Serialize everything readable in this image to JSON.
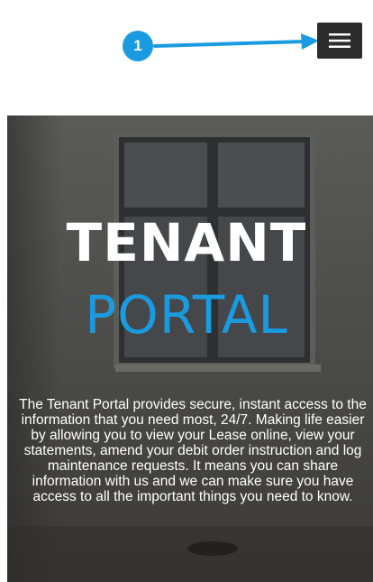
{
  "annotation": {
    "number": "1"
  },
  "menu_button": {
    "icon": "hamburger-icon"
  },
  "hero": {
    "title_line1": "TENANT",
    "title_line2": "PORTAL",
    "title_line2_color": "#1a9be0",
    "description": "The Tenant Portal provides secure, instant access to the information that you need most, 24/7. Making life easier by allowing you to view your Lease online, view your statements, amend your debit order instruction and log maintenance requests. It means you can share information with us and we can make sure you have access to all the important things you need to know."
  },
  "colors": {
    "accent": "#1a9be0",
    "menu_button_bg": "#2c2c2c",
    "hero_overlay": "#4a4a48"
  }
}
